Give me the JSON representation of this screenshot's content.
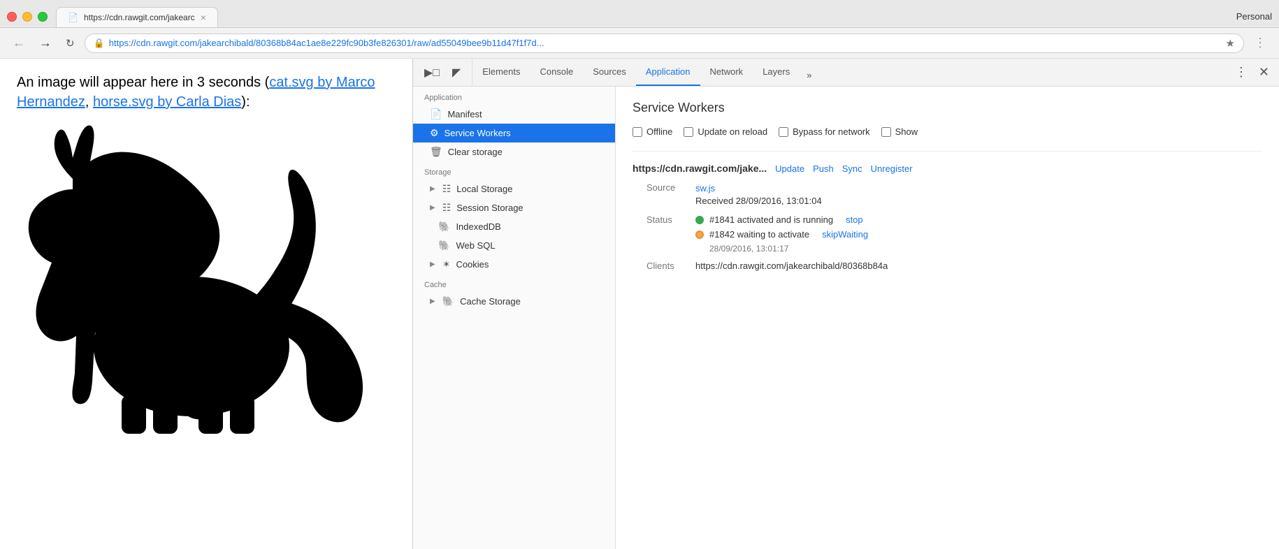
{
  "browser": {
    "tab_title": "https://cdn.rawgit.com/jakearc",
    "tab_close": "×",
    "personal_label": "Personal",
    "address_url": "https://cdn.rawgit.com/jakearchibald/80368b84ac1ae8e229fc90b3fe826301/raw/ad55049bee9b11d47f1f7d...",
    "address_url_short": "https://cdn.rawgit.com/jakearchibald/80368b84ac1ae8e229fc90b3fe826301/raw/ad55049bee9b11d47f1f7d..."
  },
  "page": {
    "text_before": "An image will appear here in 3 seconds (",
    "link1": "cat.svg by Marco Hernandez",
    "separator": ", ",
    "link2": "horse.svg by Carla Dias",
    "text_after": "):"
  },
  "devtools": {
    "tabs": [
      {
        "id": "elements",
        "label": "Elements"
      },
      {
        "id": "console",
        "label": "Console"
      },
      {
        "id": "sources",
        "label": "Sources"
      },
      {
        "id": "application",
        "label": "Application"
      },
      {
        "id": "network",
        "label": "Network"
      },
      {
        "id": "layers",
        "label": "Layers"
      }
    ],
    "more_tabs": "»",
    "sidebar": {
      "application_label": "Application",
      "items_application": [
        {
          "id": "manifest",
          "label": "Manifest",
          "icon": "doc"
        },
        {
          "id": "service-workers",
          "label": "Service Workers",
          "icon": "gear",
          "active": true
        },
        {
          "id": "clear-storage",
          "label": "Clear storage",
          "icon": "trash"
        }
      ],
      "storage_label": "Storage",
      "items_storage": [
        {
          "id": "local-storage",
          "label": "Local Storage",
          "icon": "grid",
          "expandable": true
        },
        {
          "id": "session-storage",
          "label": "Session Storage",
          "icon": "grid",
          "expandable": true
        },
        {
          "id": "indexeddb",
          "label": "IndexedDB",
          "icon": "db"
        },
        {
          "id": "web-sql",
          "label": "Web SQL",
          "icon": "db"
        },
        {
          "id": "cookies",
          "label": "Cookies",
          "icon": "cookie",
          "expandable": true
        }
      ],
      "cache_label": "Cache",
      "items_cache": [
        {
          "id": "cache-storage",
          "label": "Cache Storage",
          "icon": "db",
          "expandable": true
        }
      ]
    },
    "main": {
      "title": "Service Workers",
      "checkboxes": [
        {
          "id": "offline",
          "label": "Offline"
        },
        {
          "id": "update-on-reload",
          "label": "Update on reload"
        },
        {
          "id": "bypass-for-network",
          "label": "Bypass for network"
        },
        {
          "id": "show",
          "label": "Show"
        }
      ],
      "service_worker": {
        "url": "https://cdn.rawgit.com/jake...",
        "actions": [
          "Update",
          "Push",
          "Sync",
          "Unregister"
        ],
        "source_label": "Source",
        "source_link": "sw.js",
        "received": "Received 28/09/2016, 13:01:04",
        "status_label": "Status",
        "status_active": "#1841 activated and is running",
        "stop_link": "stop",
        "status_waiting": "#1842 waiting to activate",
        "skip_waiting_link": "skipWaiting",
        "waiting_time": "28/09/2016, 13:01:17",
        "clients_label": "Clients",
        "clients_value": "https://cdn.rawgit.com/jakearchibald/80368b84a"
      }
    }
  }
}
